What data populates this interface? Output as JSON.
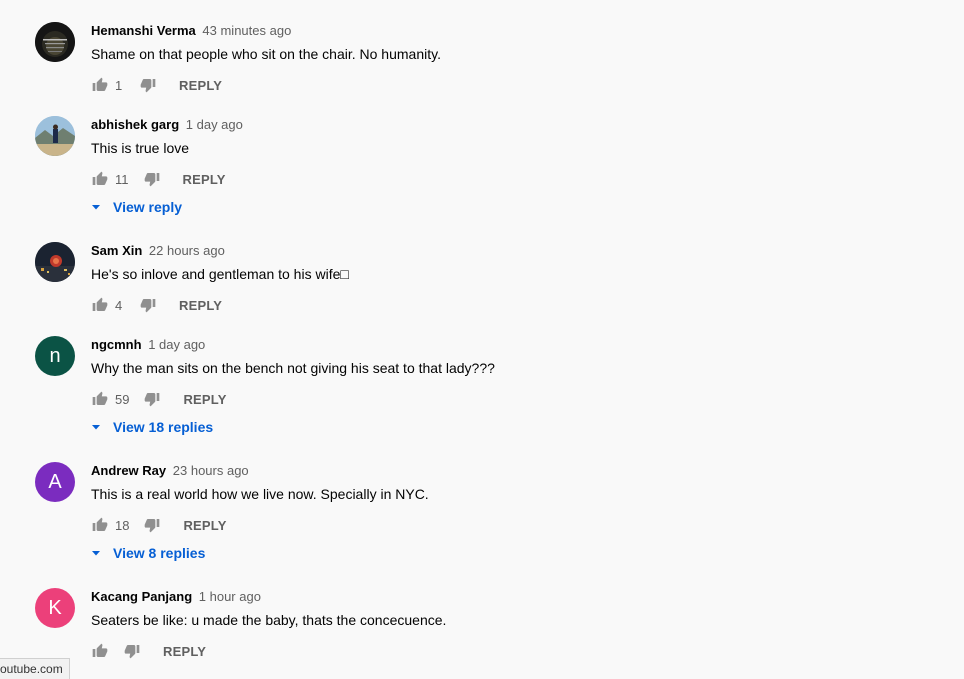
{
  "colors": {
    "background": "#f9f9f9",
    "link_blue": "#065fd4",
    "secondary_text": "#606060",
    "avatar_ngcmnh": "#0b5345",
    "avatar_andrew": "#7b2cbf",
    "avatar_kacang": "#ec407a"
  },
  "comments": [
    {
      "author": "Hemanshi Verma",
      "time": "43 minutes ago",
      "text": "Shame on that people who sit on the chair. No humanity.",
      "likes": "1",
      "reply_label": "REPLY",
      "avatar": {
        "type": "image",
        "icon": "dark-photo-avatar"
      }
    },
    {
      "author": "abhishek garg",
      "time": "1 day ago",
      "text": "This is true love",
      "likes": "11",
      "reply_label": "REPLY",
      "view_replies": "View reply",
      "avatar": {
        "type": "image",
        "icon": "landscape-photo-avatar"
      }
    },
    {
      "author": "Sam Xin",
      "time": "22 hours ago",
      "text": "He's so inlove and gentleman to his wife□",
      "likes": "4",
      "reply_label": "REPLY",
      "avatar": {
        "type": "image",
        "icon": "night-city-photo-avatar"
      }
    },
    {
      "author": "ngcmnh",
      "time": "1 day ago",
      "text": "Why the man sits on the bench not giving his seat to that lady???",
      "likes": "59",
      "reply_label": "REPLY",
      "view_replies": "View 18 replies",
      "avatar": {
        "type": "letter",
        "letter": "n"
      }
    },
    {
      "author": "Andrew Ray",
      "time": "23 hours ago",
      "text": "This is a real world how we live now. Specially in NYC.",
      "likes": "18",
      "reply_label": "REPLY",
      "view_replies": "View 8 replies",
      "avatar": {
        "type": "letter",
        "letter": "A"
      }
    },
    {
      "author": "Kacang Panjang",
      "time": "1 hour ago",
      "text": "Seaters be like: u made the baby, thats the concecuence.",
      "likes": "",
      "reply_label": "REPLY",
      "avatar": {
        "type": "letter",
        "letter": "K"
      }
    }
  ],
  "status_bar": {
    "url": "outube.com"
  }
}
